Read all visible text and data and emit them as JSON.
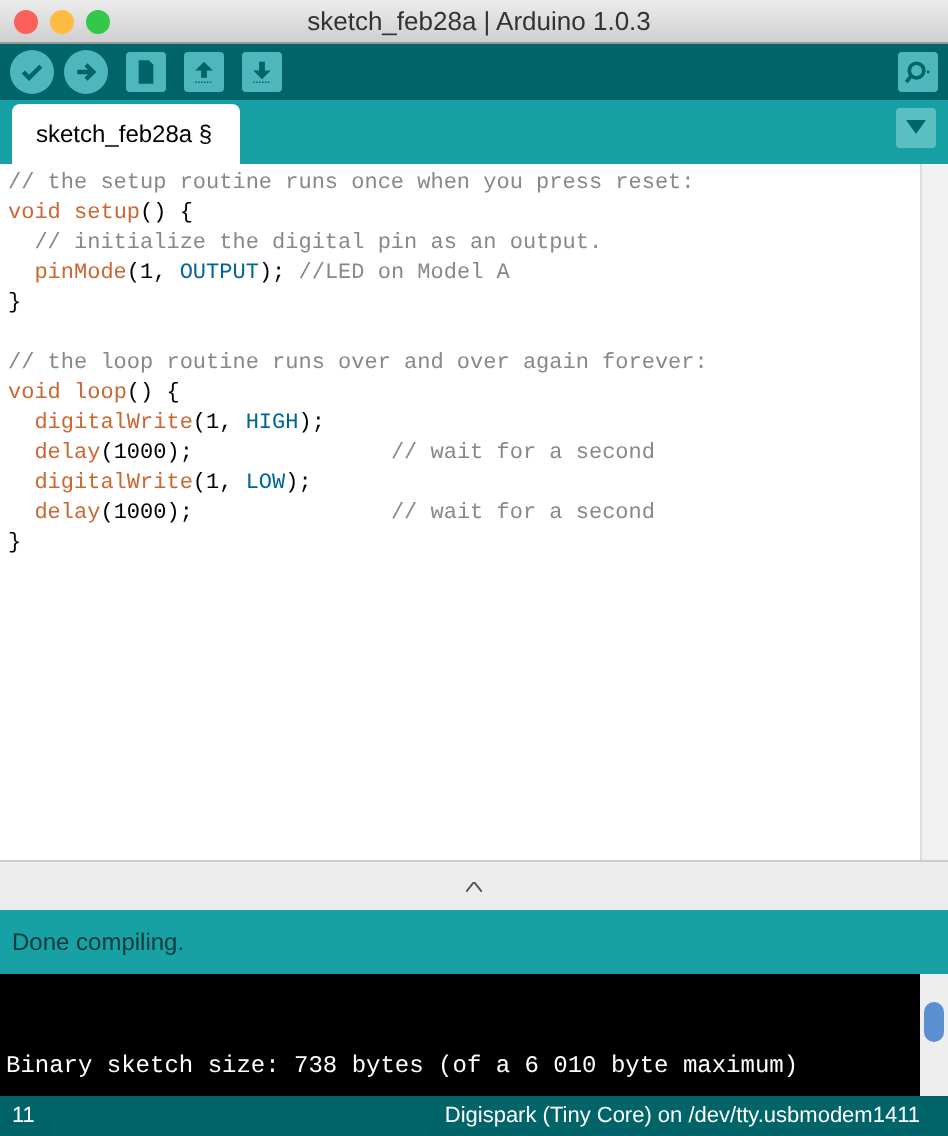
{
  "window": {
    "title": "sketch_feb28a | Arduino 1.0.3"
  },
  "toolbar": {
    "buttons": [
      {
        "kind": "verify"
      },
      {
        "kind": "upload"
      },
      {
        "kind": "new"
      },
      {
        "kind": "open"
      },
      {
        "kind": "save"
      }
    ]
  },
  "tabs": [
    {
      "label": "sketch_feb28a §",
      "selected": true
    }
  ],
  "code_lines": [
    {
      "kind": "code",
      "tokens": [
        {
          "text": "// the setup routine runs once when you press reset:",
          "kind": "comment"
        }
      ]
    },
    {
      "kind": "code",
      "tokens": [
        {
          "text": "void ",
          "kind": "keyword"
        },
        {
          "text": "setup",
          "kind": "keyword"
        },
        {
          "text": "() {",
          "kind": "plain"
        }
      ]
    },
    {
      "kind": "code",
      "tokens": [
        {
          "text": "  // initialize the digital pin as an output.",
          "kind": "comment"
        }
      ]
    },
    {
      "kind": "code",
      "tokens": [
        {
          "text": "  pinMode",
          "kind": "keyword"
        },
        {
          "text": "(1, ",
          "kind": "plain"
        },
        {
          "text": "OUTPUT",
          "kind": "constant"
        },
        {
          "text": "); ",
          "kind": "plain"
        },
        {
          "text": "//LED on Model A",
          "kind": "comment"
        }
      ]
    },
    {
      "kind": "code",
      "tokens": [
        {
          "text": "}",
          "kind": "plain"
        }
      ]
    },
    {
      "kind": "blank"
    },
    {
      "kind": "code",
      "tokens": [
        {
          "text": "// the loop routine runs over and over again forever:",
          "kind": "comment"
        }
      ]
    },
    {
      "kind": "code",
      "tokens": [
        {
          "text": "void ",
          "kind": "keyword"
        },
        {
          "text": "loop",
          "kind": "keyword"
        },
        {
          "text": "() {",
          "kind": "plain"
        }
      ]
    },
    {
      "kind": "code",
      "tokens": [
        {
          "text": "  digitalWrite",
          "kind": "keyword"
        },
        {
          "text": "(1, ",
          "kind": "plain"
        },
        {
          "text": "HIGH",
          "kind": "constant"
        },
        {
          "text": ");",
          "kind": "plain"
        }
      ]
    },
    {
      "kind": "code",
      "tokens": [
        {
          "text": "  delay",
          "kind": "keyword"
        },
        {
          "text": "(1000);               ",
          "kind": "plain"
        },
        {
          "text": "// wait for a second",
          "kind": "comment"
        }
      ]
    },
    {
      "kind": "code",
      "tokens": [
        {
          "text": "  digitalWrite",
          "kind": "keyword"
        },
        {
          "text": "(1, ",
          "kind": "plain"
        },
        {
          "text": "LOW",
          "kind": "constant"
        },
        {
          "text": ");",
          "kind": "plain"
        }
      ]
    },
    {
      "kind": "code",
      "tokens": [
        {
          "text": "  delay",
          "kind": "keyword"
        },
        {
          "text": "(1000);               ",
          "kind": "plain"
        },
        {
          "text": "// wait for a second",
          "kind": "comment"
        }
      ]
    },
    {
      "kind": "code",
      "tokens": [
        {
          "text": "}",
          "kind": "plain"
        }
      ]
    }
  ],
  "status": {
    "message": "Done compiling."
  },
  "console": {
    "lines": [
      "Binary sketch size: 738 bytes (of a 6 010 byte maximum)"
    ]
  },
  "status_bar": {
    "line": "11",
    "board": "Digispark (Tiny Core) on /dev/tty.usbmodem1411"
  }
}
